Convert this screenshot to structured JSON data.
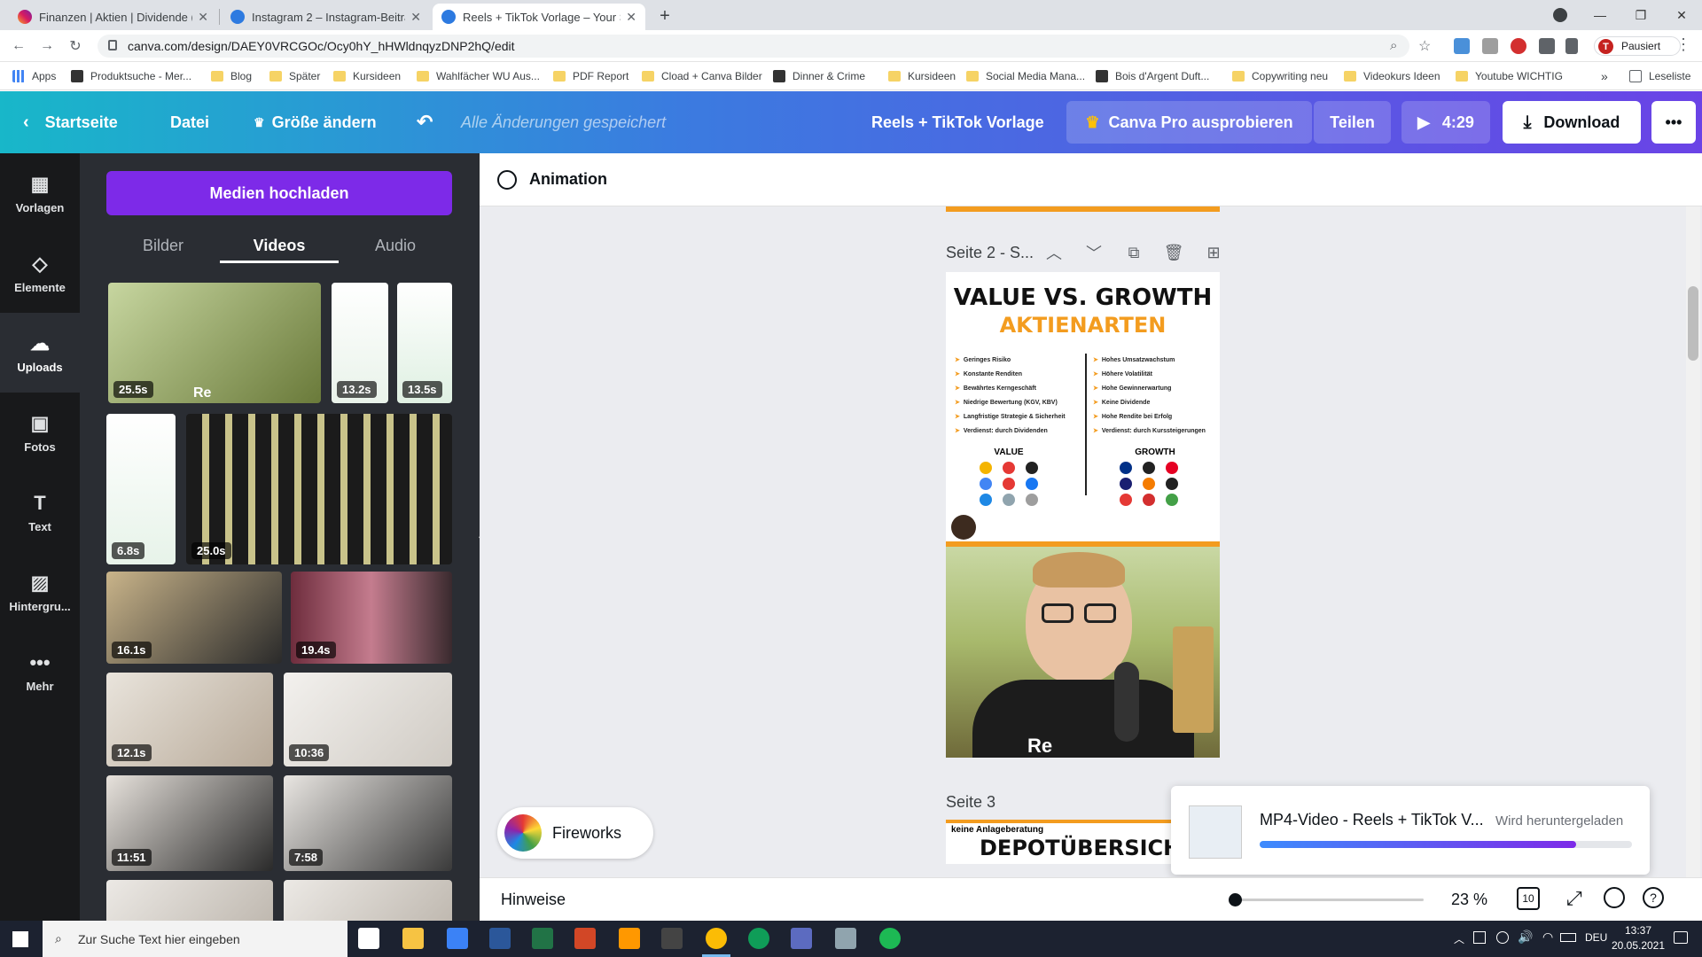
{
  "browser": {
    "tabs": [
      {
        "title": "Finanzen | Aktien | Dividende (@",
        "active": false
      },
      {
        "title": "Instagram 2 – Instagram-Beitrag",
        "active": false
      },
      {
        "title": "Reels + TikTok Vorlage – Your St",
        "active": true
      }
    ],
    "new_tab": "+",
    "window_controls": [
      "—",
      "❐",
      "✕"
    ],
    "url": "canva.com/design/DAEY0VRCGOc/Ocy0hY_hHWldnqyzDNP2hQ/edit",
    "profile_label": "Pausiert",
    "profile_initial": "T",
    "bookmarks": [
      {
        "label": "Apps",
        "kind": "apps"
      },
      {
        "label": "Produktsuche - Mer...",
        "kind": "site"
      },
      {
        "label": "Blog",
        "kind": "folder"
      },
      {
        "label": "Später",
        "kind": "folder"
      },
      {
        "label": "Kursideen",
        "kind": "folder"
      },
      {
        "label": "Wahlfächer WU Aus...",
        "kind": "folder"
      },
      {
        "label": "PDF Report",
        "kind": "folder"
      },
      {
        "label": "Cload + Canva Bilder",
        "kind": "folder"
      },
      {
        "label": "Dinner & Crime",
        "kind": "site"
      },
      {
        "label": "Kursideen",
        "kind": "folder"
      },
      {
        "label": "Social Media Mana...",
        "kind": "folder"
      },
      {
        "label": "Bois d'Argent Duft...",
        "kind": "site"
      },
      {
        "label": "Copywriting neu",
        "kind": "folder"
      },
      {
        "label": "Videokurs Ideen",
        "kind": "folder"
      },
      {
        "label": "Youtube WICHTIG",
        "kind": "folder"
      }
    ],
    "bookmarks_more": "»",
    "reading_list": "Leseliste"
  },
  "canva_header": {
    "home": "Startseite",
    "file": "Datei",
    "resize": "Größe ändern",
    "saved_status": "Alle Änderungen gespeichert",
    "design_title": "Reels + TikTok Vorlage",
    "pro": "Canva Pro ausprobieren",
    "share": "Teilen",
    "duration": "4:29",
    "download": "Download",
    "more": "•••"
  },
  "rail": [
    {
      "label": "Vorlagen",
      "icon": "templates-icon"
    },
    {
      "label": "Elemente",
      "icon": "elements-icon"
    },
    {
      "label": "Uploads",
      "icon": "upload-cloud-icon",
      "selected": true
    },
    {
      "label": "Fotos",
      "icon": "photos-icon"
    },
    {
      "label": "Text",
      "icon": "text-icon"
    },
    {
      "label": "Hintergru...",
      "icon": "background-icon"
    },
    {
      "label": "Mehr",
      "icon": "more-dots-icon"
    }
  ],
  "panel": {
    "upload_button": "Medien hochladen",
    "tabs": [
      "Bilder",
      "Videos",
      "Audio"
    ],
    "selected_tab": "Videos",
    "videos": [
      {
        "duration": "25.5s"
      },
      {
        "duration": "13.2s"
      },
      {
        "duration": "13.5s"
      },
      {
        "duration": "6.8s"
      },
      {
        "duration": "25.0s"
      },
      {
        "duration": "16.1s"
      },
      {
        "duration": "19.4s"
      },
      {
        "duration": "12.1s"
      },
      {
        "duration": "10:36"
      },
      {
        "duration": "11:51"
      },
      {
        "duration": "7:58"
      }
    ],
    "thumb_caption": "Re"
  },
  "editor": {
    "animation": "Animation",
    "page2_label": "Seite 2 - S...",
    "page3_label": "Seite 3",
    "page2": {
      "title": "VALUE VS. GROWTH",
      "subtitle": "AKTIENARTEN",
      "value_points": [
        "Geringes Risiko",
        "Konstante Renditen",
        "Bewährtes Kerngeschäft",
        "Niedrige Bewertung (KGV, KBV)",
        "Langfristige Strategie & Sicherheit",
        "Verdienst: durch Dividenden"
      ],
      "growth_points": [
        "Hohes Umsatzwachstum",
        "Höhere Volatilität",
        "Hohe Gewinnerwartung",
        "Keine Dividende",
        "Hohe Rendite bei Erfolg",
        "Verdienst: durch Kurssteigerungen"
      ],
      "value_head": "VALUE",
      "growth_head": "GROWTH",
      "shirt_text": "Re"
    },
    "page3": {
      "small": "keine Anlageberatung",
      "title": "DEPOTÜBERSICH"
    },
    "fireworks": "Fireworks",
    "download_popup": {
      "name": "MP4-Video - Reels + TikTok V...",
      "status": "Wird heruntergeladen",
      "progress": 0.85
    }
  },
  "bottom_bar": {
    "notes": "Hinweise",
    "zoom": "23 %",
    "pages": "10"
  },
  "taskbar": {
    "search_placeholder": "Zur Suche Text hier eingeben",
    "language": "DEU",
    "time": "13:37",
    "date": "20.05.2021"
  }
}
